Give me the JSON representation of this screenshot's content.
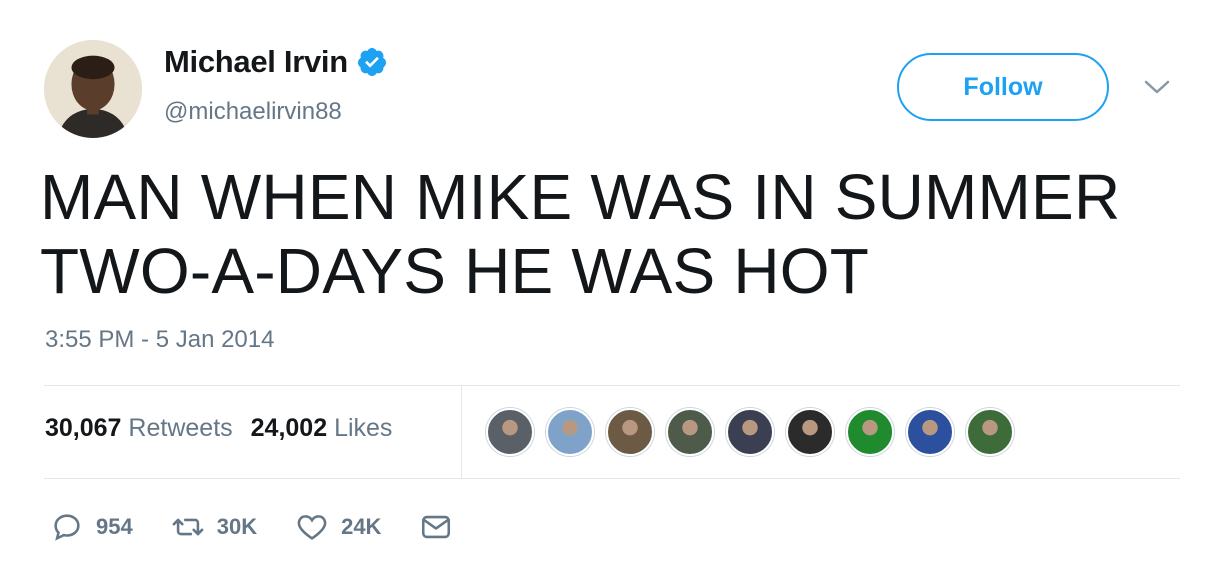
{
  "user": {
    "display_name": "Michael Irvin",
    "handle": "@michaelirvin88"
  },
  "follow_label": "Follow",
  "tweet": {
    "text_line1": "MAN WHEN MIKE WAS IN SUMMER",
    "text_line2": "TWO-A-DAYS HE WAS HOT",
    "timestamp": "3:55 PM - 5 Jan 2014"
  },
  "stats": {
    "retweets_count": "30,067",
    "retweets_label": "Retweets",
    "likes_count": "24,002",
    "likes_label": "Likes"
  },
  "likers": [
    {
      "name": "liker-avatar-1",
      "color": "#5a6068"
    },
    {
      "name": "liker-avatar-2",
      "color": "#7fa3c8"
    },
    {
      "name": "liker-avatar-3",
      "color": "#6d5a44"
    },
    {
      "name": "liker-avatar-4",
      "color": "#4e5a4a"
    },
    {
      "name": "liker-avatar-5",
      "color": "#3a3f52"
    },
    {
      "name": "liker-avatar-6",
      "color": "#2b2b2b"
    },
    {
      "name": "liker-avatar-7",
      "color": "#1f8a2e"
    },
    {
      "name": "liker-avatar-8",
      "color": "#2c4f9e"
    },
    {
      "name": "liker-avatar-9",
      "color": "#3d6b3a"
    }
  ],
  "actions": {
    "reply_count": "954",
    "retweet_count": "30K",
    "like_count": "24K"
  },
  "colors": {
    "accent": "#1da1f2",
    "text": "#14171a",
    "secondary": "#657786",
    "divider": "#e1e8ed"
  },
  "icons": [
    "verified-badge-icon",
    "chevron-down-icon",
    "reply-icon",
    "retweet-icon",
    "heart-icon",
    "direct-message-icon"
  ]
}
